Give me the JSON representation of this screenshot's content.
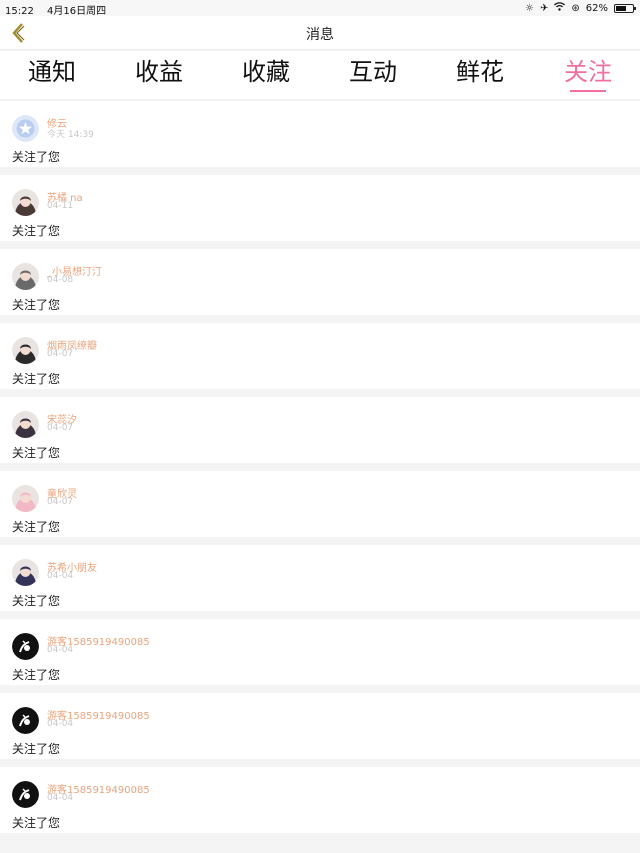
{
  "status_bar": {
    "time": "15:22",
    "date": "4月16日周四",
    "battery": "62%",
    "battery_level": 0.62
  },
  "nav": {
    "title": "消息"
  },
  "tabs": [
    {
      "label": "通知",
      "active": false
    },
    {
      "label": "收益",
      "active": false
    },
    {
      "label": "收藏",
      "active": false
    },
    {
      "label": "互动",
      "active": false
    },
    {
      "label": "鲜花",
      "active": false
    },
    {
      "label": "关注",
      "active": true
    }
  ],
  "items": [
    {
      "name": "修云",
      "date": "今天 14:39",
      "text": "关注了您",
      "avatar": "default-avatar-icon",
      "avatar_color": "#b9cdf0"
    },
    {
      "name": "苏橘 na",
      "date": "04-11",
      "text": "关注了您",
      "avatar": "user-avatar",
      "avatar_color": "#4a3a35"
    },
    {
      "name": "_小易想汀汀",
      "date": "04-08",
      "text": "关注了您",
      "avatar": "user-avatar",
      "avatar_color": "#6a6a6a"
    },
    {
      "name": "烟雨凤缭瓣",
      "date": "04-07",
      "text": "关注了您",
      "avatar": "user-avatar",
      "avatar_color": "#2b2b2b"
    },
    {
      "name": "宋蕊汐",
      "date": "04-07",
      "text": "关注了您",
      "avatar": "user-avatar",
      "avatar_color": "#3d3340"
    },
    {
      "name": "童欣灵",
      "date": "04-07",
      "text": "关注了您",
      "avatar": "user-avatar",
      "avatar_color": "#f2b8c6"
    },
    {
      "name": "苏希小朋友",
      "date": "04-04",
      "text": "关注了您",
      "avatar": "user-avatar",
      "avatar_color": "#33335a"
    },
    {
      "name": "游客1585919490085",
      "date": "04-04",
      "text": "关注了您",
      "avatar": "guest-avatar",
      "avatar_color": "#111111"
    },
    {
      "name": "游客1585919490085",
      "date": "04-04",
      "text": "关注了您",
      "avatar": "guest-avatar",
      "avatar_color": "#111111"
    },
    {
      "name": "游客1585919490085",
      "date": "04-04",
      "text": "关注了您",
      "avatar": "guest-avatar",
      "avatar_color": "#111111"
    }
  ]
}
